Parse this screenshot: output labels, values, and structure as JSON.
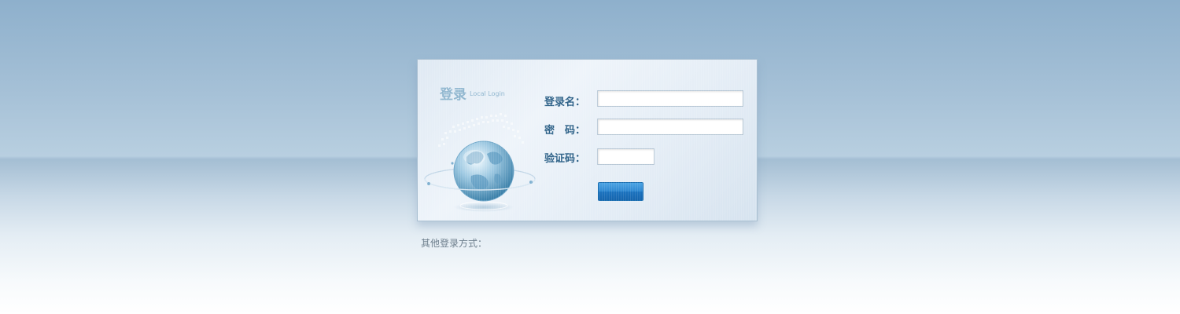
{
  "login_panel": {
    "title": "登录",
    "subtitle": "Local Login",
    "fields": {
      "username": {
        "label": "登录名：",
        "value": ""
      },
      "password": {
        "label": "密　码：",
        "value": ""
      },
      "captcha": {
        "label": "验证码：",
        "value": ""
      }
    },
    "submit_label": ""
  },
  "other_login": {
    "label": "其他登录方式："
  },
  "colors": {
    "label_text": "#2a5f86",
    "title_text": "#8fb6cf",
    "button_blue": "#1b72bf",
    "background_top": "#8eb0cc"
  },
  "icons": {
    "globe": "globe-icon"
  }
}
